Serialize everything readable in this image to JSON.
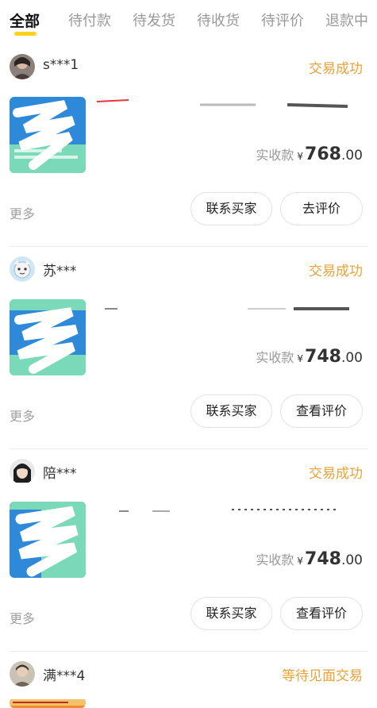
{
  "tabs": [
    {
      "label": "全部",
      "active": true
    },
    {
      "label": "待付款"
    },
    {
      "label": "待发货"
    },
    {
      "label": "待收货"
    },
    {
      "label": "待评价"
    },
    {
      "label": "退款中"
    }
  ],
  "orders": [
    {
      "buyer": "s***1",
      "status": "交易成功",
      "price_label": "实收款",
      "currency": "¥",
      "price_int": "768",
      "price_dec": ".00",
      "more": "更多",
      "contact_label": "联系买家",
      "review_label": "去评价"
    },
    {
      "buyer": "苏***",
      "status": "交易成功",
      "price_label": "实收款",
      "currency": "¥",
      "price_int": "748",
      "price_dec": ".00",
      "more": "更多",
      "contact_label": "联系买家",
      "review_label": "查看评价"
    },
    {
      "buyer": "陪***",
      "status": "交易成功",
      "price_label": "实收款",
      "currency": "¥",
      "price_int": "748",
      "price_dec": ".00",
      "more": "更多",
      "contact_label": "联系买家",
      "review_label": "查看评价"
    },
    {
      "buyer": "满***4",
      "status": "等待见面交易"
    }
  ],
  "colors": {
    "status": "#e8a237",
    "tab_indicator": "#ffd21f",
    "thumb_bg": "#2e8ad8",
    "thumb_accent": "#79d9b8"
  }
}
